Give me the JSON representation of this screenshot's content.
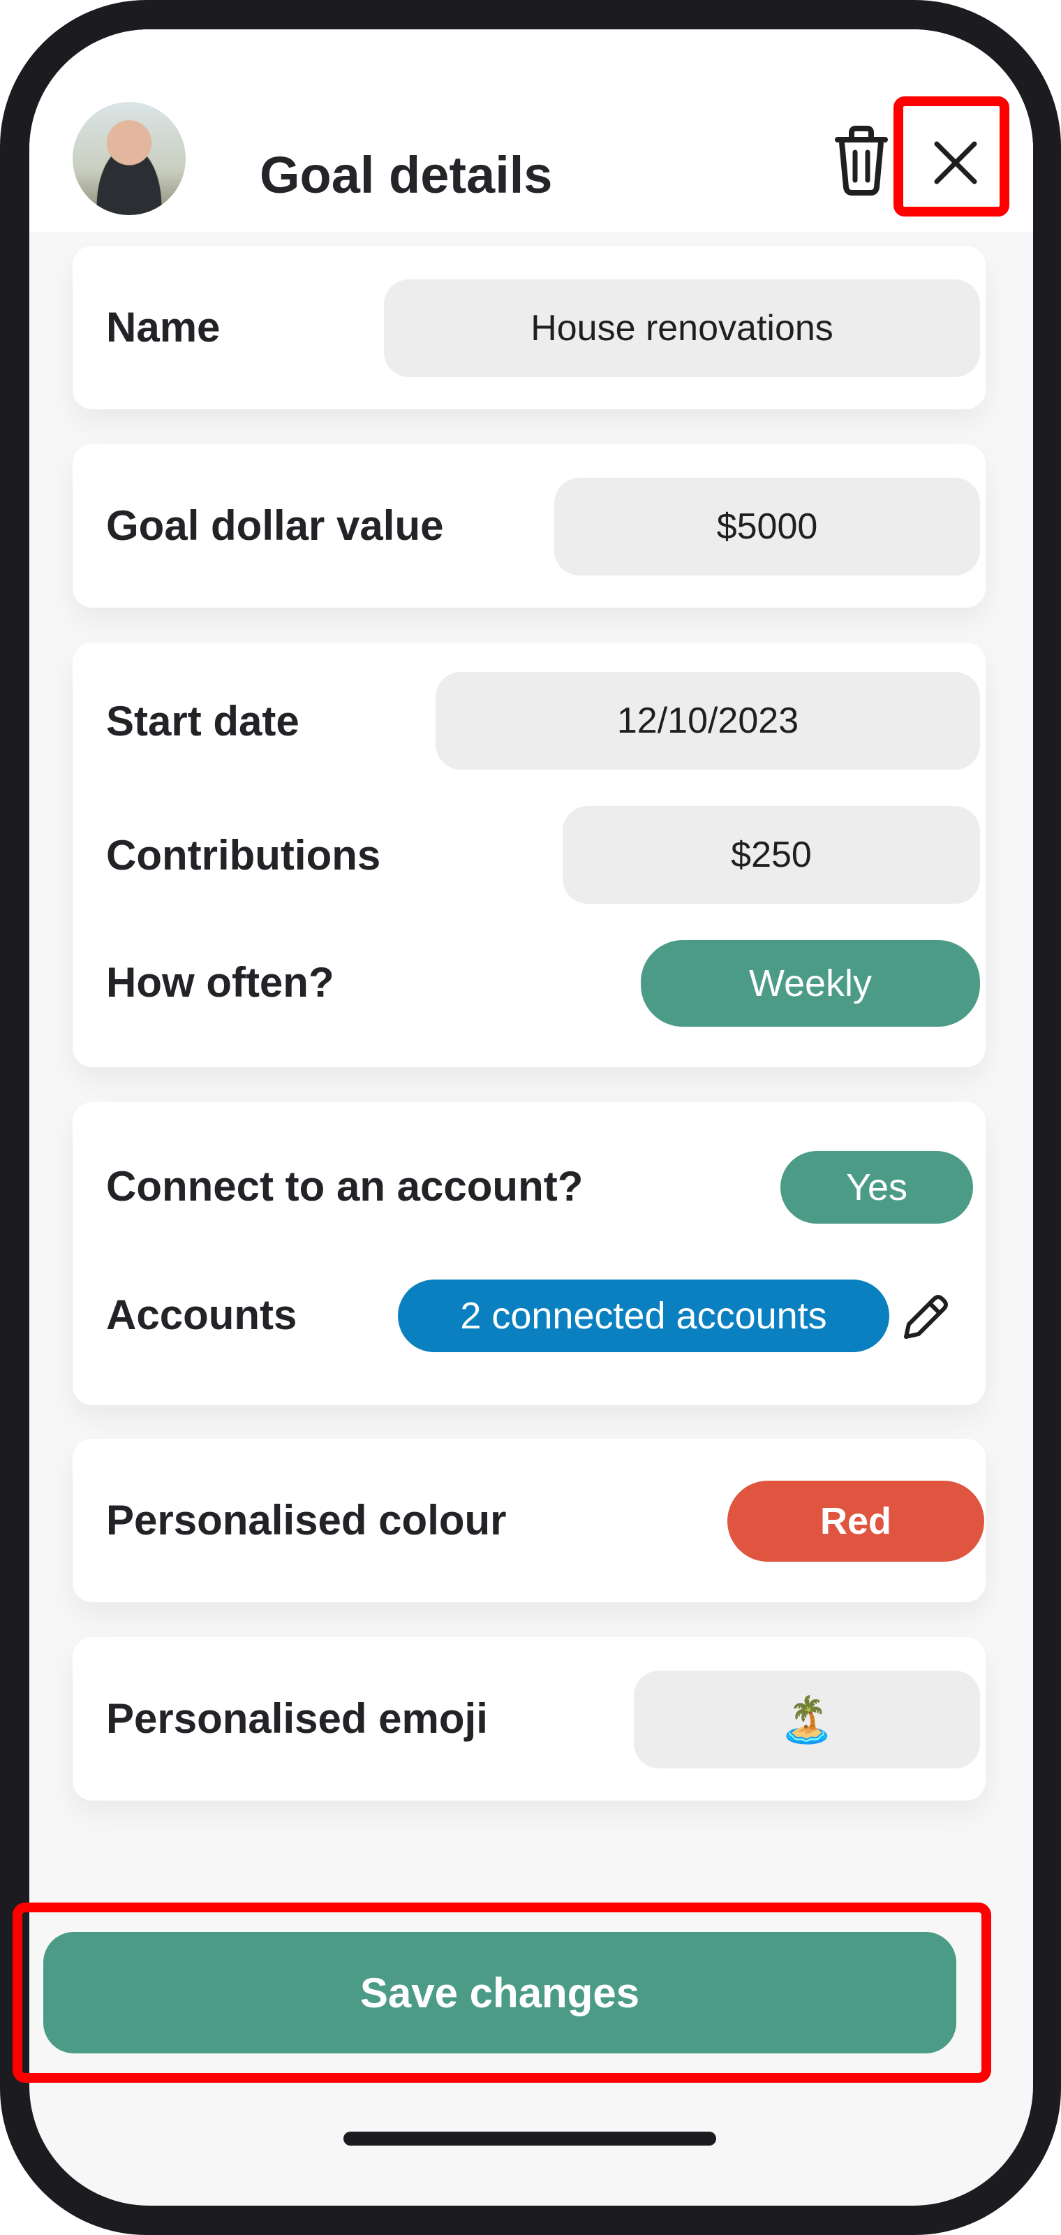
{
  "header": {
    "title": "Goal details"
  },
  "name_row": {
    "label": "Name",
    "value": "House renovations"
  },
  "goal_value_row": {
    "label": "Goal dollar value",
    "value": "$5000"
  },
  "schedule": {
    "start_label": "Start date",
    "start_value": "12/10/2023",
    "contrib_label": "Contributions",
    "contrib_value": "$250",
    "often_label": "How often?",
    "often_value": "Weekly"
  },
  "connect": {
    "question_label": "Connect to an account?",
    "answer": "Yes",
    "accounts_label": "Accounts",
    "accounts_value": "2 connected accounts"
  },
  "colour_row": {
    "label": "Personalised colour",
    "value": "Red"
  },
  "emoji_row": {
    "label": "Personalised emoji",
    "value": "🏝️"
  },
  "footer": {
    "save_label": "Save changes"
  },
  "icons": {
    "delete": "trash-icon",
    "close": "close-icon",
    "edit": "pencil-icon"
  },
  "colors": {
    "green": "#4b9b87",
    "blue": "#0a80c0",
    "red": "#e05540",
    "highlight": "#ff0000"
  }
}
